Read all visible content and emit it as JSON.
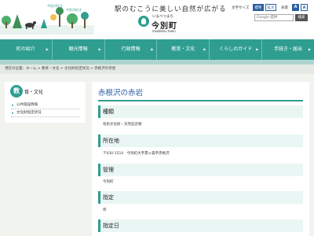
{
  "header": {
    "catchphrase": "駅のむこうに美しい自然が広がる",
    "logo_ruby": "いまべつまち",
    "logo_name": "今別町",
    "logo_roman": "imabetsu town",
    "illust_label_1": "今別が好き",
    "illust_label_2": "今別が好き",
    "font_size_label": "文字サイズ",
    "font_size_standard": "標準",
    "font_size_large": "拡大",
    "bg_label": "背景",
    "bg_option_1": "A",
    "bg_option_2": "A",
    "search_placeholder": "Google 提供",
    "search_button": "検索"
  },
  "nav": {
    "items": [
      "町の紹介",
      "観光情報",
      "行政情報",
      "教育・文化",
      "くらしのガイド",
      "手続き・届出"
    ]
  },
  "breadcrumb": "現在の位置：ホーム > 教育・文化 > 文化財指定状況 > 赤根沢の赤岩",
  "sidebar": {
    "badge": "教",
    "title": "育・文化",
    "links": [
      "公共施設情報",
      "文化財指定状況"
    ]
  },
  "main": {
    "title": "赤根沢の赤岩",
    "sections": [
      {
        "heading": "種類",
        "value": "有形文化財・天然記念物"
      },
      {
        "heading": "所在地",
        "value": "〒030-1514　今別町大字袰ヶ森字赤根沢"
      },
      {
        "heading": "管理",
        "value": "今別町"
      },
      {
        "heading": "指定",
        "value": "県"
      },
      {
        "heading": "指定日",
        "value": ""
      }
    ]
  }
}
